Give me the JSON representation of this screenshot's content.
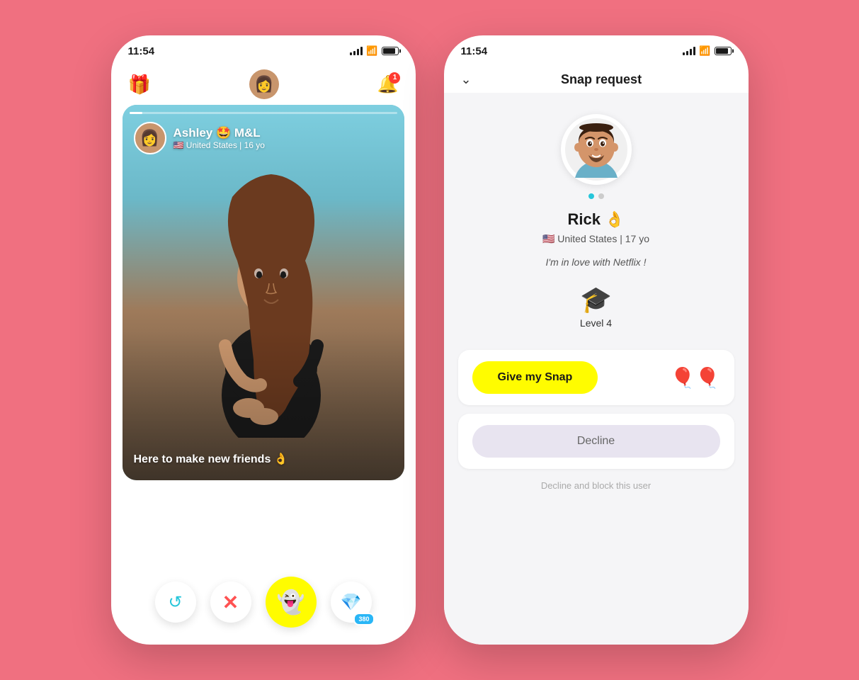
{
  "left_phone": {
    "status_time": "11:54",
    "gift_label": "🎁",
    "center_avatar_emoji": "👩",
    "notification_count": "1",
    "card": {
      "user_name": "Ashley 🤩 M&L",
      "user_sub": "🇺🇸 United States | 16 yo",
      "user_avatar_emoji": "👩",
      "bottom_text": "Here to make new friends 👌",
      "progress_pct": 5
    },
    "actions": {
      "undo": "↺",
      "cross": "✕",
      "snap": "👻",
      "diamond": "💎",
      "diamond_count": "380"
    }
  },
  "right_phone": {
    "status_time": "11:54",
    "header_chevron": "∨",
    "header_title": "Snap request",
    "profile": {
      "avatar_emoji": "🧔",
      "name": "Rick 👌",
      "location": "🇺🇸 United States | 17 yo",
      "bio": "I'm in love with Netflix !",
      "level_icon": "🎓",
      "level_text": "Level 4"
    },
    "buttons": {
      "give_snap": "Give my Snap",
      "balloons": "🎈🎈",
      "decline": "Decline",
      "decline_block": "Decline and block this user"
    }
  }
}
